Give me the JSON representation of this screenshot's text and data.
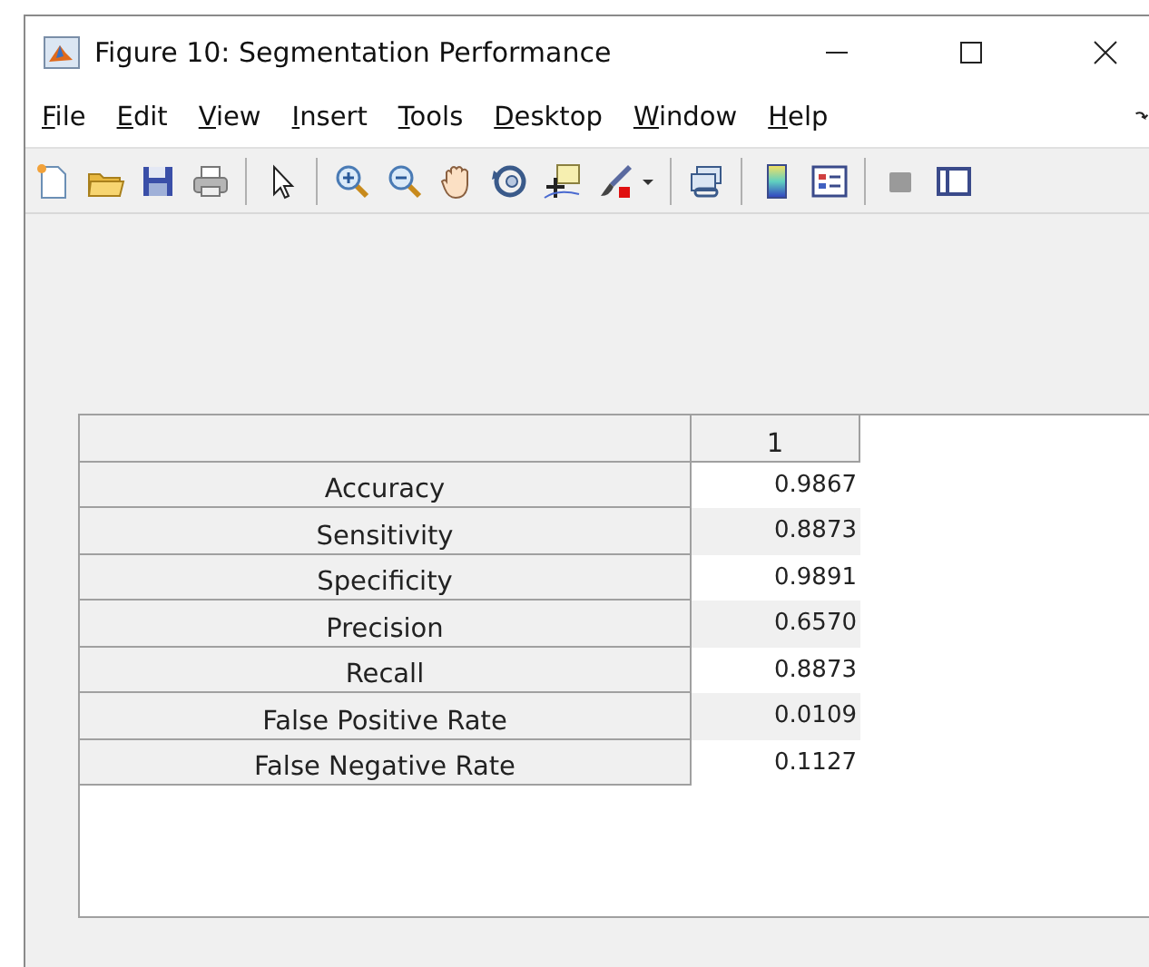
{
  "window": {
    "title": "Figure 10: Segmentation Performance"
  },
  "menu": [
    "File",
    "Edit",
    "View",
    "Insert",
    "Tools",
    "Desktop",
    "Window",
    "Help"
  ],
  "table": {
    "columns": [
      "1"
    ],
    "rows": [
      {
        "label": "Accuracy",
        "value": "0.9867"
      },
      {
        "label": "Sensitivity",
        "value": "0.8873"
      },
      {
        "label": "Specificity",
        "value": "0.9891"
      },
      {
        "label": "Precision",
        "value": "0.6570"
      },
      {
        "label": "Recall",
        "value": "0.8873"
      },
      {
        "label": "False Positive Rate",
        "value": "0.0109"
      },
      {
        "label": "False Negative Rate",
        "value": "0.1127"
      }
    ]
  }
}
